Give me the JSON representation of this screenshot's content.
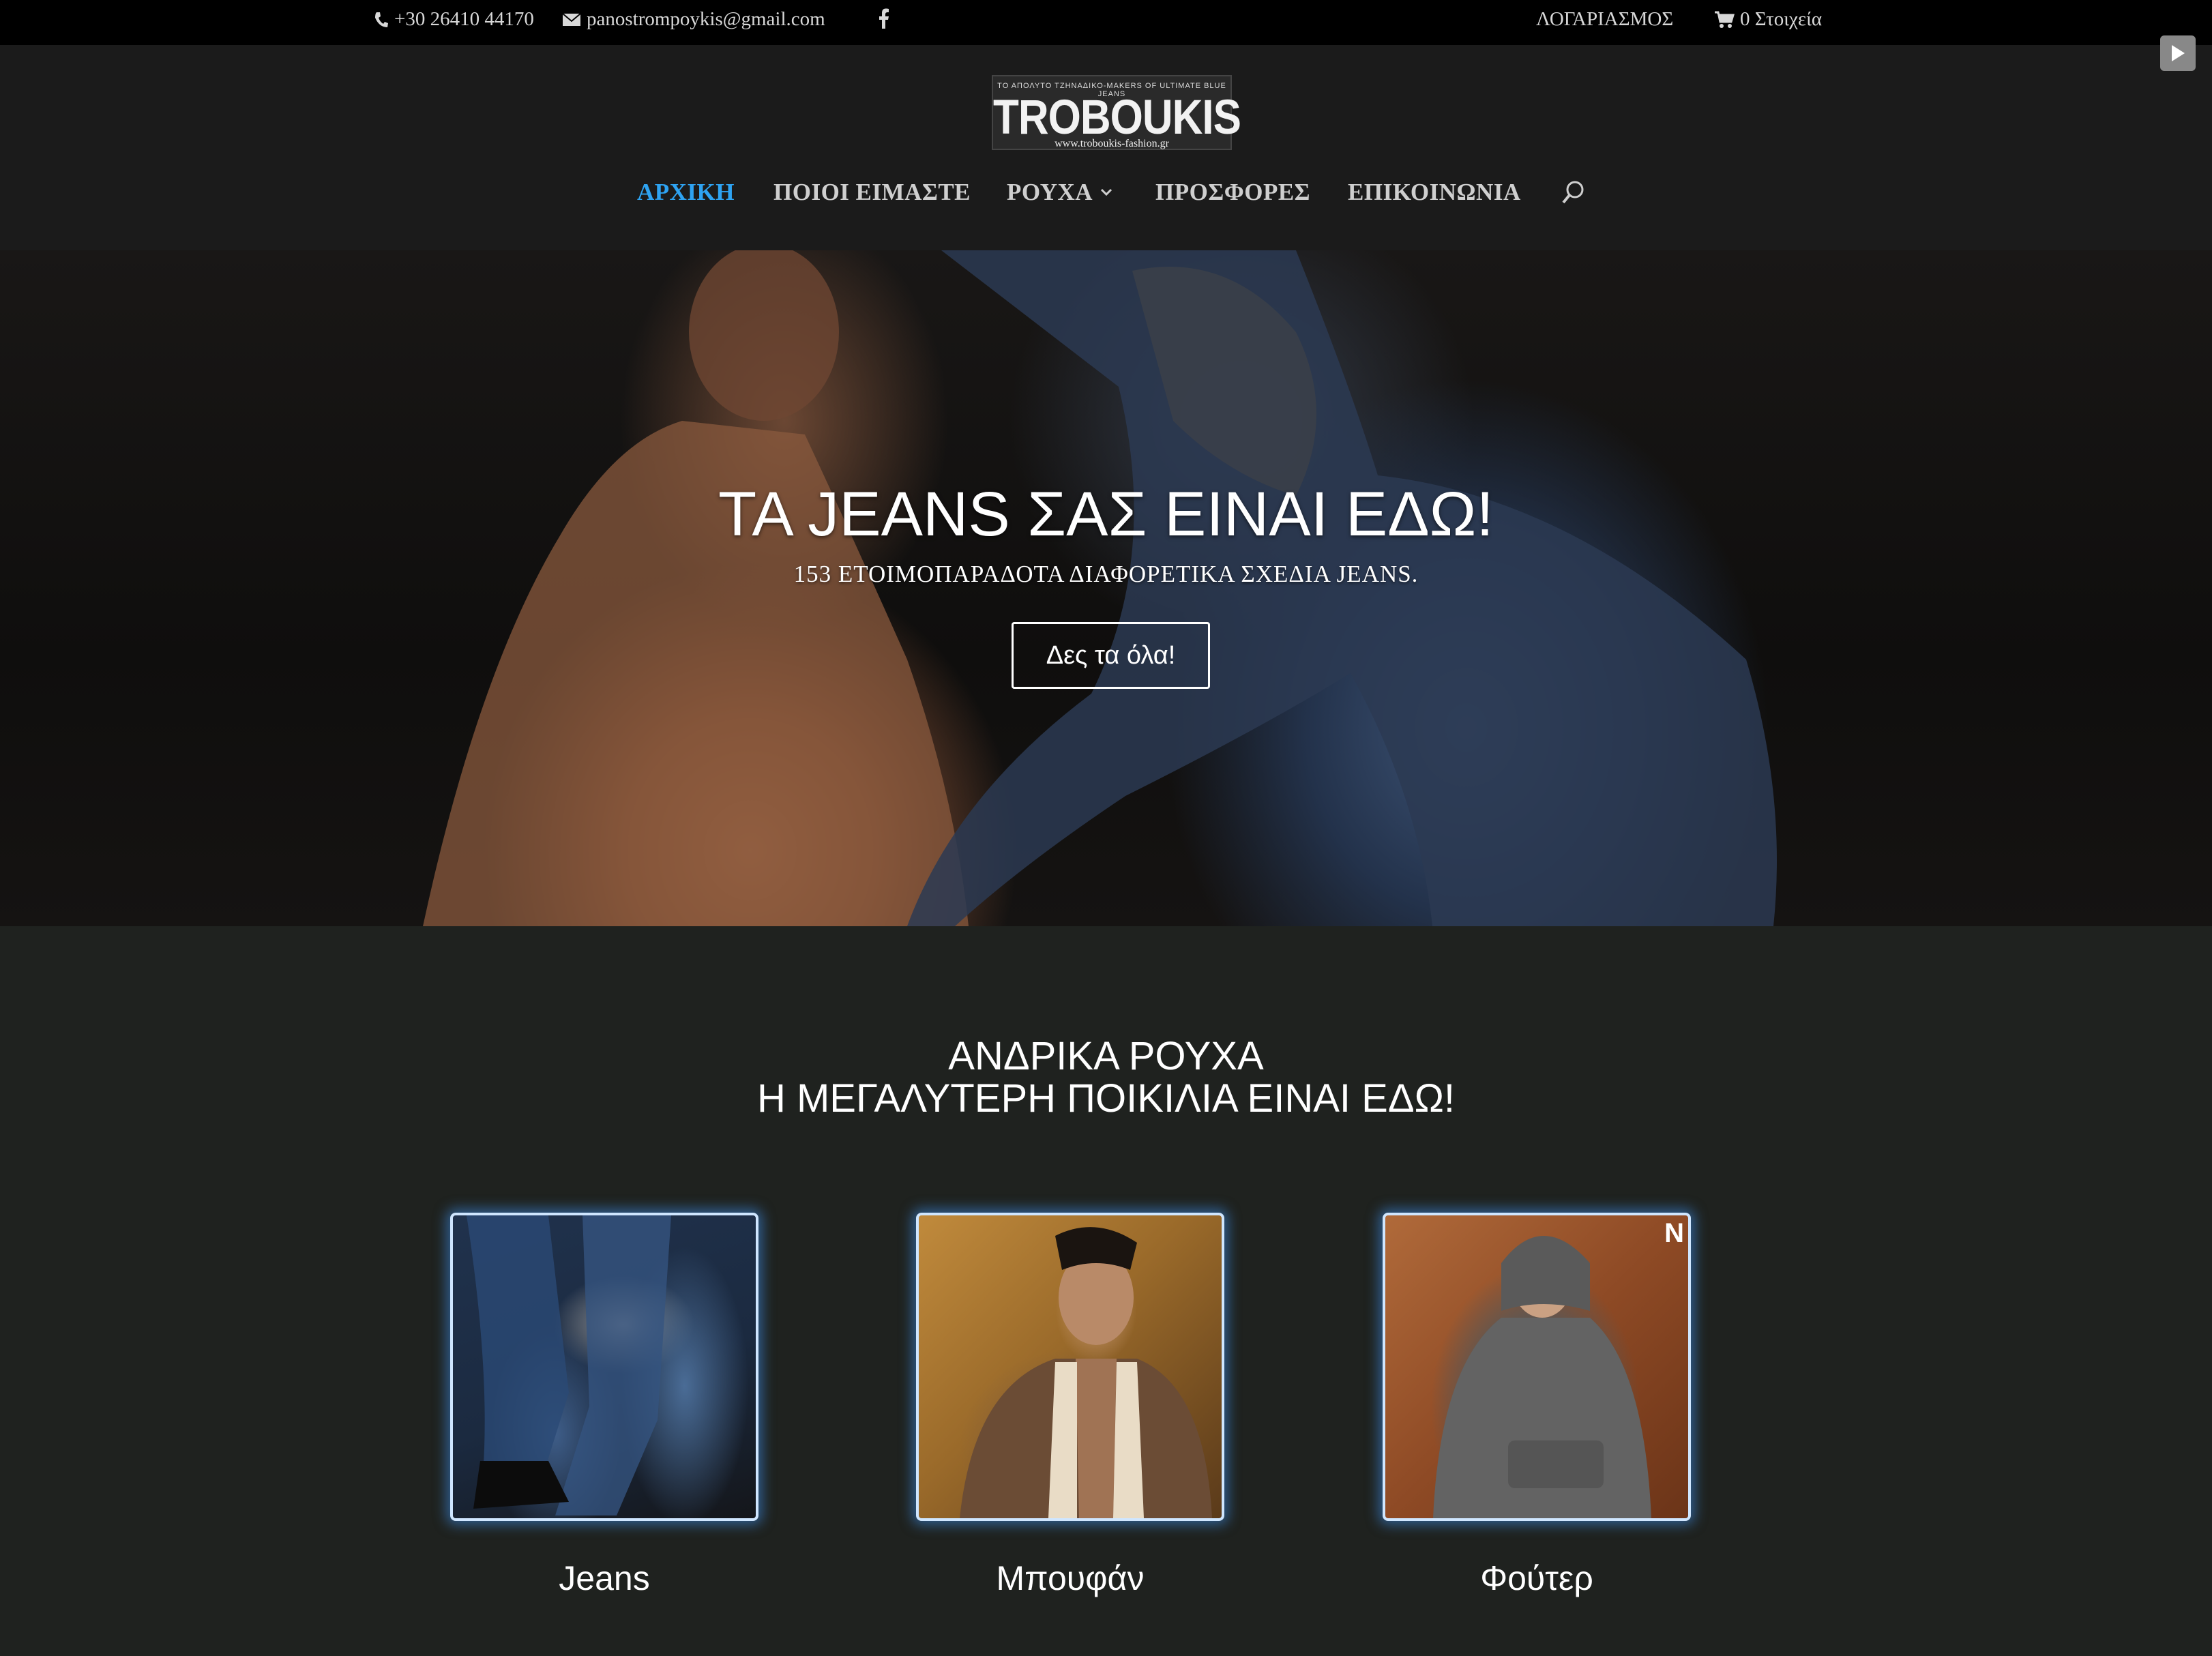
{
  "topbar": {
    "phone": "+30 26410 44170",
    "email": "panostrompoykis@gmail.com",
    "account": "ΛΟΓΑΡΙΑΣΜΟΣ",
    "cart": "0 Στοιχεία"
  },
  "logo": {
    "tagline": "ΤΟ ΑΠΟΛΥΤΟ ΤΖΗΝΑΔΙΚΟ-MAKERS OF ULTIMATE BLUE JEANS",
    "brand": "TROBOUKIS",
    "url": "www.troboukis-fashion.gr"
  },
  "nav": {
    "items": [
      {
        "label": "ΑΡΧΙΚΗ",
        "active": true
      },
      {
        "label": "ΠΟΙΟΙ ΕΙΜΑΣΤΕ"
      },
      {
        "label": "ΡΟΥΧΑ",
        "has_dropdown": true
      },
      {
        "label": "ΠΡΟΣΦΟΡΕΣ"
      },
      {
        "label": "ΕΠΙΚΟΙΝΩΝΙΑ"
      }
    ],
    "active_color": "#2ea3f2"
  },
  "hero": {
    "title": "ΤΑ JEANS ΣΑΣ ΕΙΝΑΙ ΕΔΩ!",
    "subtitle": "153 ΕΤΟΙΜΟΠΑΡΑΔΟΤΑ ΔΙΑΦΟΡΕΤΙΚΑ ΣΧΕΔΙΑ JEANS.",
    "button": "Δες τα όλα!"
  },
  "section": {
    "title_line1": "ΑΝΔΡΙΚΑ ΡΟΥΧΑ",
    "title_line2": "Η ΜΕΓΑΛΥΤΕΡΗ ΠΟΙΚΙΛΙΑ ΕΙΝΑΙ ΕΔΩ!"
  },
  "categories": [
    {
      "label": "Jeans"
    },
    {
      "label": "Μπουφάν"
    },
    {
      "label": "Φούτερ",
      "badge": "N"
    }
  ]
}
